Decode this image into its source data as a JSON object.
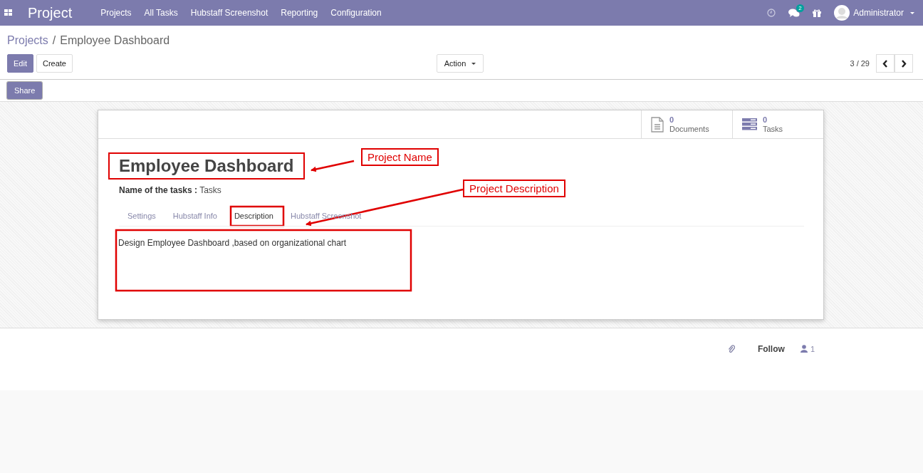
{
  "navbar": {
    "app_name": "Project",
    "menu": [
      "Projects",
      "All Tasks",
      "Hubstaff Screenshot",
      "Reporting",
      "Configuration"
    ],
    "messages_count": "2",
    "user": "Administrator"
  },
  "breadcrumb": {
    "parent": "Projects",
    "separator": "/",
    "current": "Employee Dashboard"
  },
  "buttons": {
    "edit": "Edit",
    "create": "Create",
    "action": "Action",
    "share": "Share"
  },
  "pager": {
    "value": "3 / 29"
  },
  "smart_buttons": [
    {
      "kind": "documents",
      "count": "0",
      "label": "Documents"
    },
    {
      "kind": "tasks",
      "count": "0",
      "label": "Tasks"
    }
  ],
  "form": {
    "title": "Employee Dashboard",
    "field_label": "Name of the tasks :",
    "field_value": "Tasks",
    "tabs": [
      {
        "label": "Settings",
        "selected": false
      },
      {
        "label": "Hubstaff Info",
        "selected": false
      },
      {
        "label": "Description",
        "selected": true
      },
      {
        "label": "Hubstaff Screenshot",
        "selected": false
      }
    ],
    "description": "Design Employee Dashboard ,based on organizational chart"
  },
  "annotations": {
    "name_label": "Project Name",
    "description_label": "Project Description"
  },
  "chatter": {
    "follow": "Follow",
    "followers": "1"
  }
}
